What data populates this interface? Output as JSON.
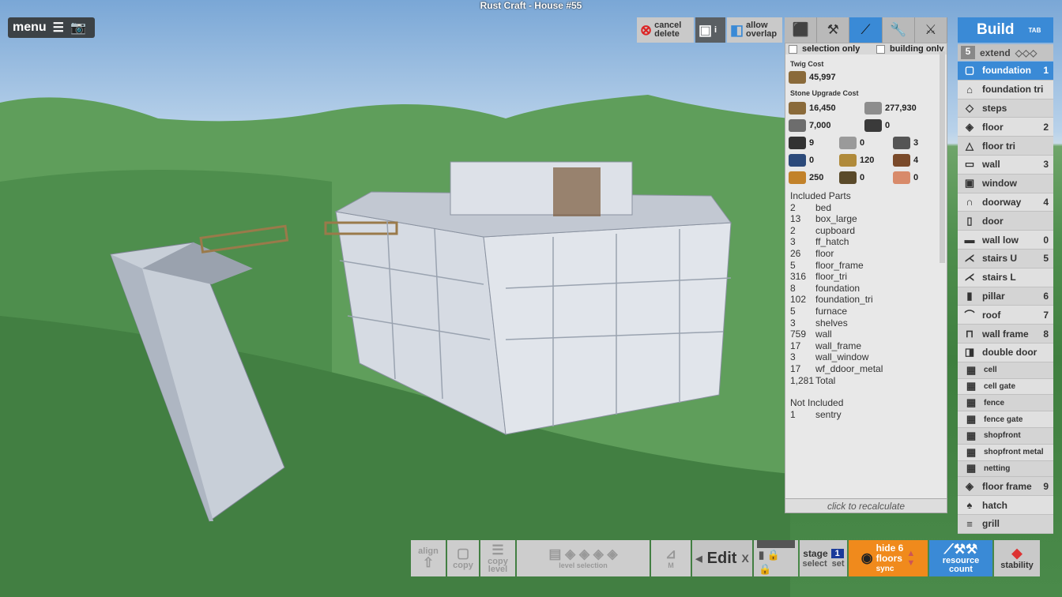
{
  "title": "Rust Craft - House #55",
  "menu": {
    "label": "menu"
  },
  "toolbar": {
    "cancel_delete_1": "cancel",
    "cancel_delete_2": "delete",
    "allow_overlap_1": "allow",
    "allow_overlap_2": "overlap",
    "info": "i"
  },
  "selection": {
    "selection_only": "selection only",
    "building_only": "building only"
  },
  "cost": {
    "twig_header": "Twig Cost",
    "twig_value": "45,997",
    "stone_header": "Stone Upgrade Cost",
    "items": [
      {
        "value": "16,450",
        "color": "#8a6a3a"
      },
      {
        "value": "277,930",
        "color": "#8d8d8d"
      },
      {
        "value": "7,000",
        "color": "#6d6d6d"
      },
      {
        "value": "0",
        "color": "#3a3a3a"
      },
      {
        "value": "9",
        "color": "#333"
      },
      {
        "value": "0",
        "color": "#9a9a9a"
      },
      {
        "value": "3",
        "color": "#555"
      },
      {
        "value": "0",
        "color": "#2c4a7a"
      },
      {
        "value": "120",
        "color": "#b08a3a"
      },
      {
        "value": "4",
        "color": "#7a4a2a"
      },
      {
        "value": "250",
        "color": "#c2822a"
      },
      {
        "value": "0",
        "color": "#5a4a2a"
      },
      {
        "value": "0",
        "color": "#d88a6a"
      }
    ]
  },
  "included": {
    "header": "Included Parts",
    "rows": [
      [
        "2",
        "bed"
      ],
      [
        "13",
        "box_large"
      ],
      [
        "2",
        "cupboard"
      ],
      [
        "3",
        "ff_hatch"
      ],
      [
        "26",
        "floor"
      ],
      [
        "5",
        "floor_frame"
      ],
      [
        "316",
        "floor_tri"
      ],
      [
        "8",
        "foundation"
      ],
      [
        "102",
        "foundation_tri"
      ],
      [
        "5",
        "furnace"
      ],
      [
        "3",
        "shelves"
      ],
      [
        "759",
        "wall"
      ],
      [
        "17",
        "wall_frame"
      ],
      [
        "3",
        "wall_window"
      ],
      [
        "17",
        "wf_ddoor_metal"
      ],
      [
        "1,281",
        "Total"
      ]
    ]
  },
  "not_included": {
    "header": "Not Included",
    "rows": [
      [
        "1",
        "sentry"
      ]
    ]
  },
  "recalc": "click to recalculate",
  "build": {
    "title": "Build",
    "tab": "TAB",
    "extend_num": "5",
    "extend": "extend",
    "items": [
      {
        "label": "foundation",
        "key": "1",
        "icon": "▢",
        "active": true
      },
      {
        "label": "foundation tri",
        "key": "",
        "icon": "⌂"
      },
      {
        "label": "steps",
        "key": "",
        "icon": "◇"
      },
      {
        "label": "floor",
        "key": "2",
        "icon": "◈"
      },
      {
        "label": "floor tri",
        "key": "",
        "icon": "△"
      },
      {
        "label": "wall",
        "key": "3",
        "icon": "▭"
      },
      {
        "label": "window",
        "key": "",
        "icon": "▣"
      },
      {
        "label": "doorway",
        "key": "4",
        "icon": "∩"
      },
      {
        "label": "door",
        "key": "",
        "icon": "▯"
      },
      {
        "label": "wall low",
        "key": "0",
        "icon": "▬"
      },
      {
        "label": "stairs U",
        "key": "5",
        "icon": "⋌"
      },
      {
        "label": "stairs L",
        "key": "",
        "icon": "⋌"
      },
      {
        "label": "pillar",
        "key": "6",
        "icon": "▮"
      },
      {
        "label": "roof",
        "key": "7",
        "icon": "⌒"
      },
      {
        "label": "wall frame",
        "key": "8",
        "icon": "⊓"
      },
      {
        "label": "double door",
        "key": "",
        "icon": "◨"
      }
    ],
    "small_items": [
      "cell",
      "cell gate",
      "fence",
      "fence gate",
      "shopfront",
      "shopfront metal",
      "netting"
    ],
    "items2": [
      {
        "label": "floor frame",
        "key": "9",
        "icon": "◈"
      },
      {
        "label": "hatch",
        "key": "",
        "icon": "♠"
      },
      {
        "label": "grill",
        "key": "",
        "icon": "≡"
      }
    ]
  },
  "bottom": {
    "align": "align",
    "copy": "copy",
    "copy_level_1": "copy",
    "copy_level_2": "level",
    "level_selection": "level selection",
    "m": "M",
    "edit": "Edit",
    "x": "X",
    "stage": "stage",
    "stage_num": "1",
    "select": "select",
    "set": "set",
    "hide_floors_1": "hide",
    "hide_floors_2": "floors",
    "hide_num": "6",
    "sync": "sync",
    "resource_1": "resource",
    "resource_2": "count",
    "stability": "stability"
  }
}
